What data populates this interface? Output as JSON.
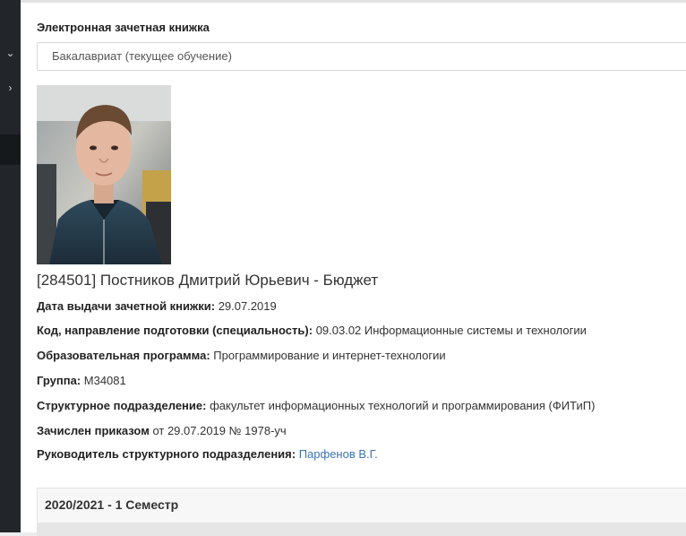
{
  "sidebar": {
    "icons": [
      "chevron-down-icon",
      "chevron-right-icon"
    ],
    "chevron_down": "⌄",
    "chevron_right": "›"
  },
  "page": {
    "section_title": "Электронная зачетная книжка",
    "program_select": {
      "value": "Бакалавриат (текущее обучение)"
    }
  },
  "student": {
    "heading": "[284501] Постников Дмитрий Юрьевич - Бюджет",
    "fields": [
      {
        "label": "Дата выдачи зачетной книжки:",
        "value": "29.07.2019"
      },
      {
        "label": "Код, направление подготовки (специальность):",
        "value": "09.03.02 Информационные системы и технологии"
      },
      {
        "label": "Образовательная программа:",
        "value": "Программирование и интернет-технологии"
      },
      {
        "label": "Группа:",
        "value": "M34081"
      },
      {
        "label": "Структурное подразделение:",
        "value": "факультет информационных технологий и программирования (ФИТиП)"
      },
      {
        "label": "Зачислен приказом",
        "value": "от 29.07.2019 № 1978-уч"
      },
      {
        "label": "Руководитель структурного подразделения:",
        "value": "Парфенов В.Г."
      }
    ]
  },
  "semester": {
    "title": "2020/2021 - 1 Семестр"
  },
  "colors": {
    "link": "#3a73b3",
    "sidebar": "#22262a"
  }
}
